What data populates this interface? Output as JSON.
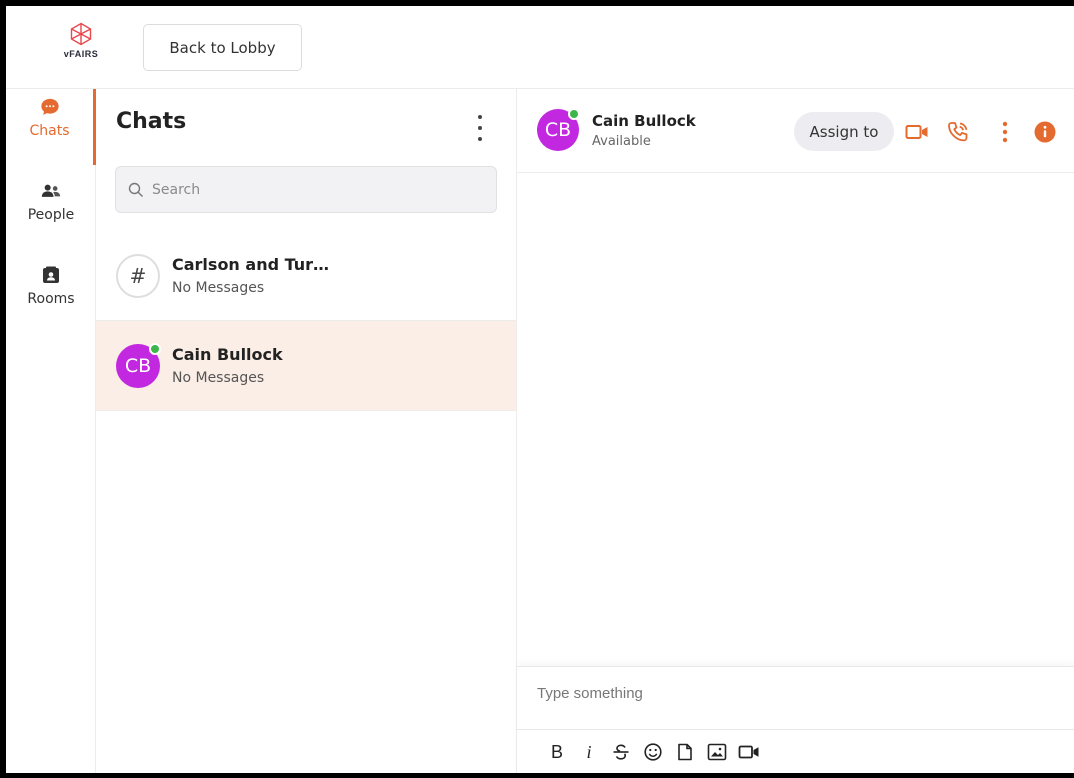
{
  "brand": {
    "logo_text": "vFAIRS",
    "accent_color": "#e46a2f"
  },
  "topbar": {
    "back_label": "Back to Lobby"
  },
  "rail": {
    "items": [
      {
        "label": "Chats",
        "icon": "chat-bubble-icon",
        "active": true
      },
      {
        "label": "People",
        "icon": "people-icon",
        "active": false
      },
      {
        "label": "Rooms",
        "icon": "rooms-icon",
        "active": false
      }
    ]
  },
  "chats": {
    "title": "Chats",
    "search_placeholder": "Search",
    "list": [
      {
        "name": "Carlson and Tur…",
        "preview": "No Messages",
        "avatar": "#",
        "type": "group",
        "selected": false
      },
      {
        "name": "Cain Bullock",
        "preview": "No Messages",
        "avatar": "CB",
        "type": "user",
        "online": true,
        "selected": true
      }
    ]
  },
  "conversation": {
    "name": "Cain Bullock",
    "status": "Available",
    "avatar": "CB",
    "assign_label": "Assign to",
    "composer_placeholder": "Type something",
    "toolbar": [
      "B",
      "i"
    ]
  }
}
